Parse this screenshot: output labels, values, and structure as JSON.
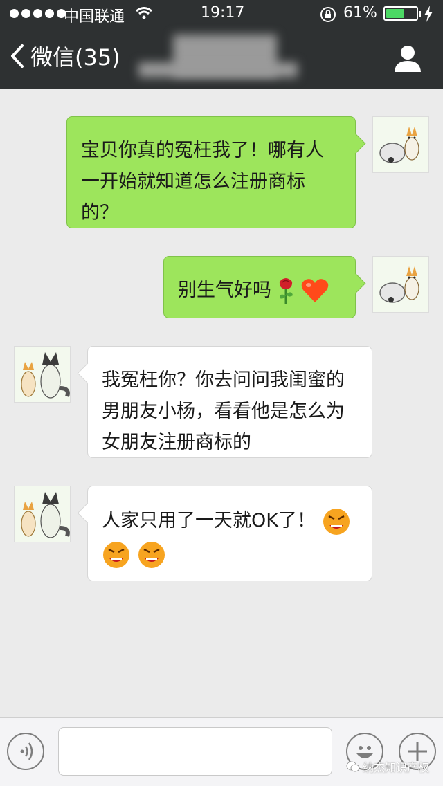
{
  "status_bar": {
    "carrier": "中国联通",
    "time": "19:17",
    "battery_percent": "61%",
    "battery_level": 0.61
  },
  "nav": {
    "back_label": "微信(35)"
  },
  "messages": [
    {
      "side": "right",
      "text_lines": [
        "宝贝你真的冤枉我了！哪有人",
        "一开始就知道怎么注册商标",
        "的？"
      ]
    },
    {
      "side": "right",
      "text": "别生气好吗",
      "emoji": [
        "rose-emoji",
        "heart-emoji"
      ]
    },
    {
      "side": "left",
      "text_lines": [
        "我冤枉你？你去问问我闺蜜的",
        "男朋友小杨，看看他是怎么为",
        "女朋友注册商标的"
      ]
    },
    {
      "side": "left",
      "text": "人家只用了一天就OK了！",
      "emoji": [
        "angry-face-emoji",
        "angry-face-emoji",
        "angry-face-emoji"
      ]
    }
  ],
  "watermark": "纳杰知识产权",
  "colors": {
    "bar": "#2e3132",
    "my_bubble": "#9de55c",
    "their_bubble": "#ffffff",
    "background": "#ebebeb"
  }
}
